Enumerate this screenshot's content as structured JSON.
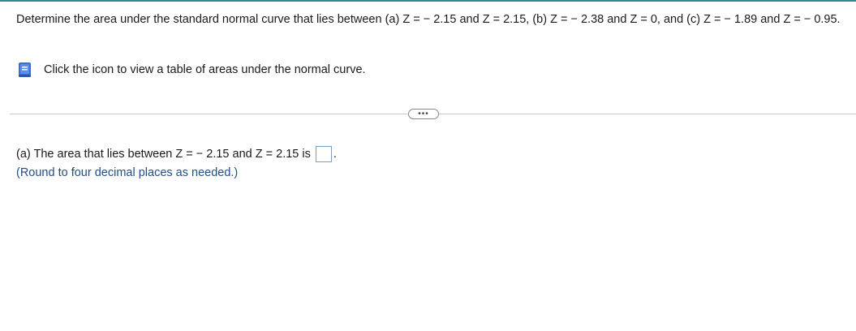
{
  "question": {
    "text": "Determine the area under the standard normal curve that lies between (a) Z = − 2.15 and Z = 2.15, (b) Z = − 2.38 and Z = 0, and (c) Z = − 1.89 and Z = − 0.95."
  },
  "reference": {
    "icon": "book-icon",
    "label": "Click the icon to view a table of areas under the normal curve."
  },
  "toolbar": {
    "more_label": "•••"
  },
  "part_a": {
    "prompt": "(a) The area that lies between Z = − 2.15 and Z = 2.15 is",
    "answer_value": "",
    "period": ".",
    "hint": "(Round to four decimal places as needed.)"
  },
  "colors": {
    "accent_rule": "#2a8c8c",
    "hint_text": "#1f4e8c",
    "icon_blue": "#3a6fd8"
  }
}
